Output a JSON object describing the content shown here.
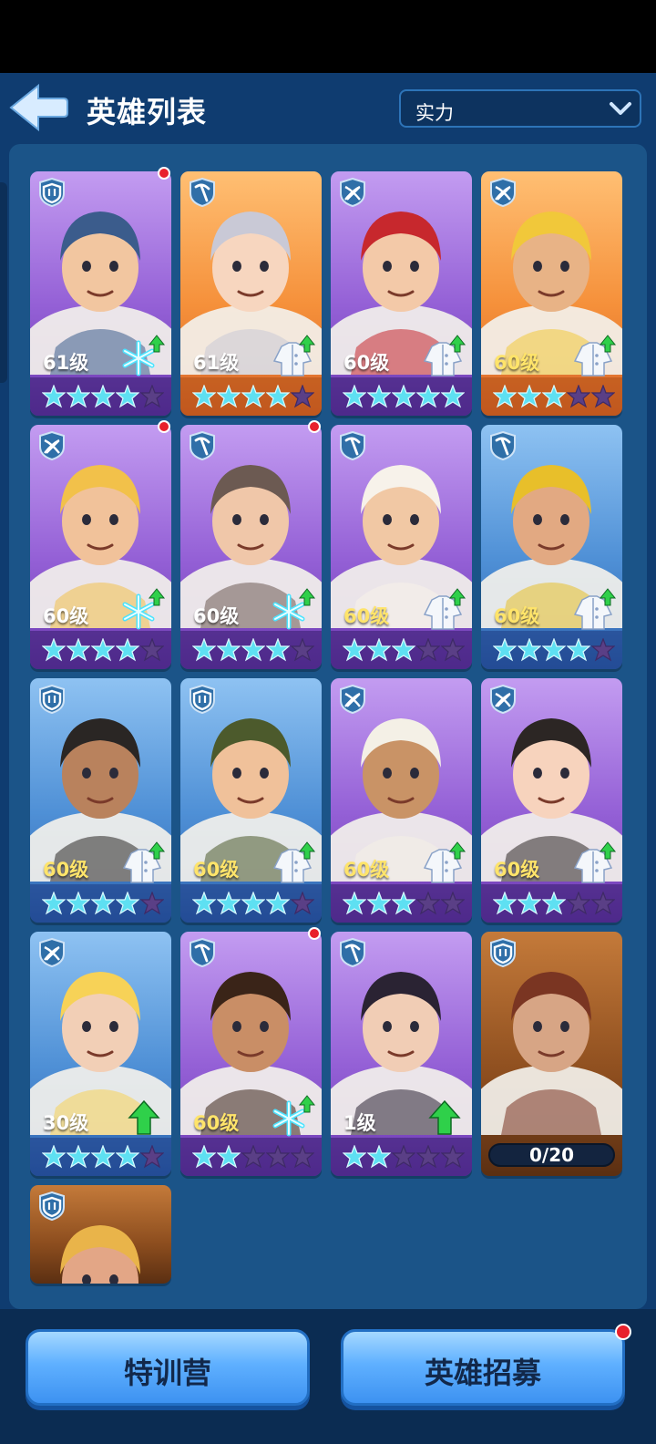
{
  "header": {
    "title": "英雄列表",
    "sort": {
      "selected": "实力"
    }
  },
  "heroes": [
    {
      "role": "shield-icon",
      "bg": "purple",
      "level": "61级",
      "gold": false,
      "upgrade": "snowflake-icon",
      "stars": 4,
      "notify": true,
      "skin": "#f2c6a0",
      "hair": "#3b5c8c"
    },
    {
      "role": "pickaxe-icon",
      "bg": "orange",
      "level": "61级",
      "gold": false,
      "upgrade": "coat-icon",
      "stars": 4,
      "notify": false,
      "skin": "#f7d6bf",
      "hair": "#c9c9d6"
    },
    {
      "role": "crossbow-icon",
      "bg": "purple",
      "level": "60级",
      "gold": false,
      "upgrade": "coat-icon",
      "stars": 5,
      "notify": false,
      "skin": "#f3c9a8",
      "hair": "#c7282d"
    },
    {
      "role": "crossbow-icon",
      "bg": "orange",
      "level": "60级",
      "gold": true,
      "upgrade": "coat-icon",
      "stars": 3,
      "notify": false,
      "skin": "#e8b386",
      "hair": "#f1c83a"
    },
    {
      "role": "crossbow-icon",
      "bg": "purple",
      "level": "60级",
      "gold": false,
      "upgrade": "snowflake-icon",
      "stars": 4,
      "notify": true,
      "skin": "#f1c29a",
      "hair": "#f2c14a"
    },
    {
      "role": "pickaxe-icon",
      "bg": "purple",
      "level": "60级",
      "gold": false,
      "upgrade": "snowflake-icon",
      "stars": 4,
      "notify": true,
      "skin": "#f0c7a9",
      "hair": "#6c5a52"
    },
    {
      "role": "pickaxe-icon",
      "bg": "purple",
      "level": "60级",
      "gold": true,
      "upgrade": "coat-icon",
      "stars": 3,
      "notify": false,
      "skin": "#f1c8a4",
      "hair": "#f7f2ea"
    },
    {
      "role": "pickaxe-icon",
      "bg": "blue",
      "level": "60级",
      "gold": true,
      "upgrade": "coat-icon",
      "stars": 4,
      "notify": false,
      "skin": "#e2a982",
      "hair": "#e8bf2a"
    },
    {
      "role": "shield-icon",
      "bg": "blue",
      "level": "60级",
      "gold": true,
      "upgrade": "coat-icon",
      "stars": 4,
      "notify": false,
      "skin": "#b9825d",
      "hair": "#2a2624"
    },
    {
      "role": "shield-icon",
      "bg": "blue",
      "level": "60级",
      "gold": true,
      "upgrade": "coat-icon",
      "stars": 4,
      "notify": false,
      "skin": "#f0c19a",
      "hair": "#4c5a2c"
    },
    {
      "role": "crossbow-icon",
      "bg": "purple",
      "level": "60级",
      "gold": true,
      "upgrade": "coat-icon",
      "stars": 3,
      "notify": false,
      "skin": "#c99366",
      "hair": "#f4f0e6"
    },
    {
      "role": "crossbow-icon",
      "bg": "purple",
      "level": "60级",
      "gold": true,
      "upgrade": "coat-icon",
      "stars": 3,
      "notify": false,
      "skin": "#f7d3bd",
      "hair": "#2c2624"
    },
    {
      "role": "crossbow-icon",
      "bg": "blue",
      "level": "30级",
      "gold": false,
      "upgrade": "arrow-up-icon",
      "stars": 4,
      "notify": false,
      "skin": "#f2cfb6",
      "hair": "#f7d257"
    },
    {
      "role": "pickaxe-icon",
      "bg": "purple",
      "level": "60级",
      "gold": true,
      "upgrade": "snowflake-icon",
      "stars": 2,
      "notify": true,
      "skin": "#c98e66",
      "hair": "#3a2418"
    },
    {
      "role": "pickaxe-icon",
      "bg": "purple",
      "level": "1级",
      "gold": false,
      "upgrade": "arrow-up-icon",
      "stars": 2,
      "notify": false,
      "skin": "#f1cdb5",
      "hair": "#2a2333"
    },
    {
      "role": "shield-icon",
      "bg": "locked",
      "shards": "0/20",
      "notify": false,
      "skin": "#d7a585",
      "hair": "#7a3522"
    },
    {
      "role": "shield-icon",
      "bg": "locked",
      "partial": true,
      "notify": false,
      "skin": "#e3a686",
      "hair": "#e9b44a"
    }
  ],
  "buttons": {
    "training": "特训营",
    "recruit": "英雄招募"
  },
  "colors": {
    "star": "#5ee0f2",
    "star_empty": "#5a3f86",
    "upgrade_arrow": "#2fd04a",
    "gold_text": "#ffe46a"
  }
}
